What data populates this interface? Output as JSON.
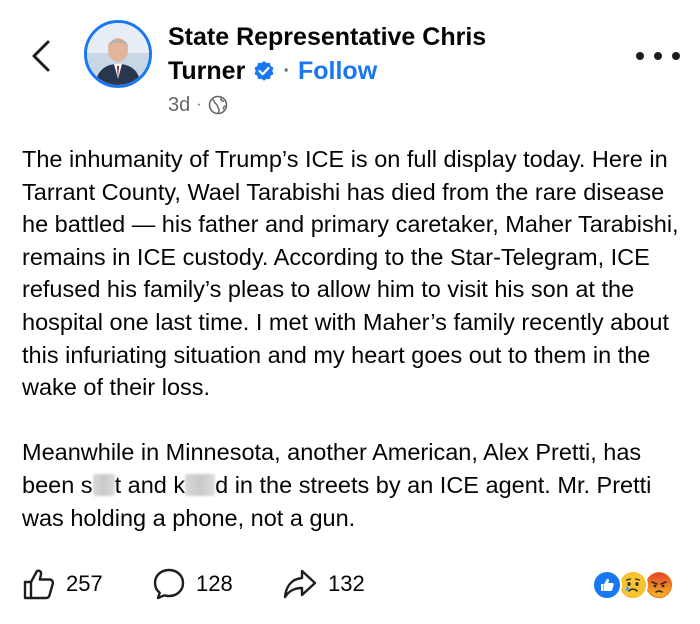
{
  "post": {
    "author": {
      "name_line1": "State Representative Chris",
      "name_line2": "Turner",
      "verified": true,
      "follow_label": "Follow",
      "separator": "·"
    },
    "meta": {
      "time": "3d",
      "dot": "·",
      "audience_icon": "globe-icon"
    },
    "body": {
      "paragraph1": "The inhumanity of Trump’s ICE is on full display today. Here in Tarrant County, Wael Tarabishi has died from the rare disease he battled — his father and primary caretaker, Maher Tarabishi, remains in ICE custody. According to the Star-Telegram, ICE refused his family’s pleas to allow him to visit his son at the hospital one last time.  I met with Maher’s family recently about this infuriating situation and my heart goes out to them in the wake of their loss.",
      "p2_a": "Meanwhile in Minnesota, another American, Alex Pretti, has been s",
      "p2_b": "t and k",
      "p2_c": "d in the streets by an ICE agent. Mr. Pretti was holding a phone, not a gun."
    },
    "actions": {
      "likes": "257",
      "comments": "128",
      "shares": "132"
    },
    "reactions": [
      "like-reaction-icon",
      "sad-reaction-icon",
      "angry-reaction-icon"
    ]
  },
  "colors": {
    "accent": "#1877f2",
    "text": "#050505",
    "muted": "#65676b"
  }
}
